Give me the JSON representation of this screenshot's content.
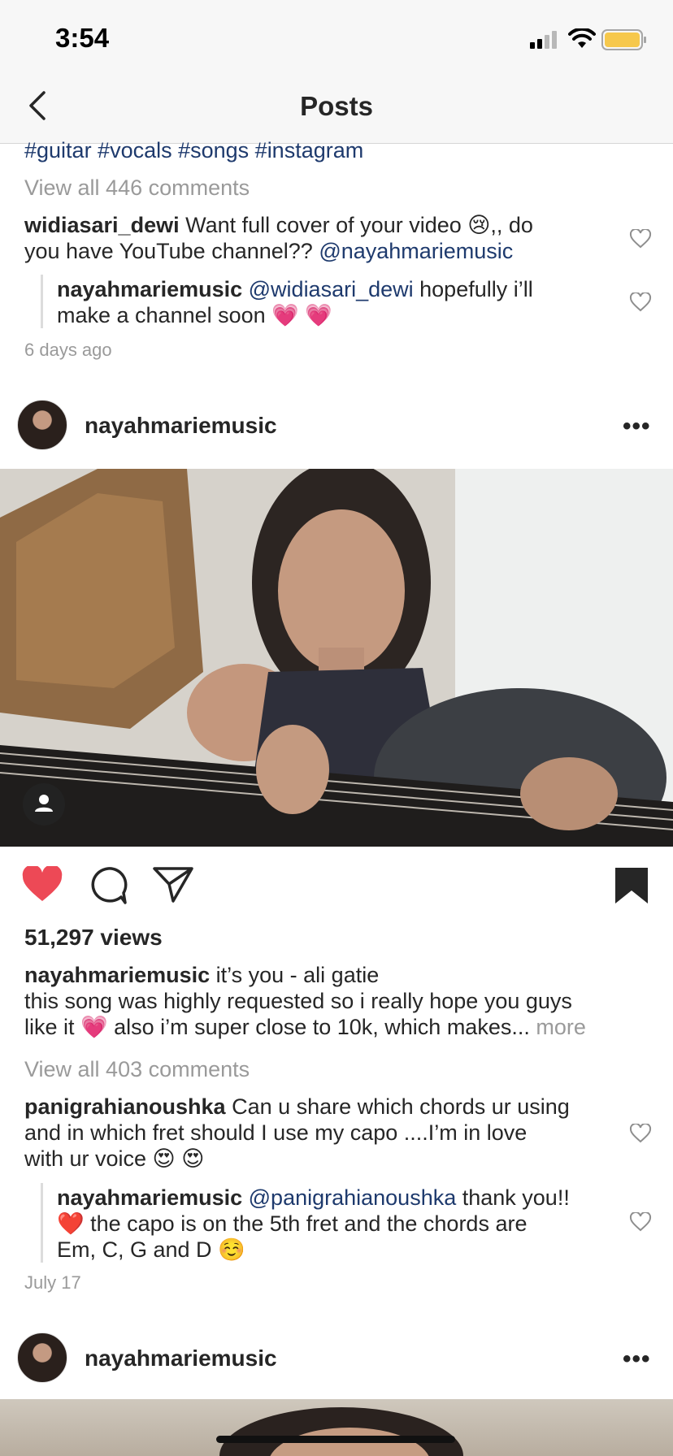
{
  "status_bar": {
    "time": "3:54"
  },
  "header": {
    "title": "Posts"
  },
  "post1": {
    "hashtags": "#guitar #vocals #songs #instagram",
    "view_comments": "View all 446 comments",
    "comment": {
      "user": "widiasari_dewi",
      "text_a": " Want full cover of your video 😢,, do",
      "text_b": "you have  YouTube channel?? ",
      "mention": "@nayahmariemusic"
    },
    "reply": {
      "user": "nayahmariemusic",
      "mention": "@widiasari_dewi",
      "text_a": " hopefully i’ll",
      "text_b": "make a channel soon 💗 💗"
    },
    "timestamp": "6 days ago"
  },
  "post2": {
    "username": "nayahmariemusic",
    "more_dots": "•••",
    "views": "51,297 views",
    "caption": {
      "user": "nayahmariemusic",
      "title": " it’s you - ali gatie",
      "line1": "this song was highly requested so i really hope you guys",
      "line2": "like it 💗 also i’m super close to 10k, which makes... ",
      "more": "more"
    },
    "view_comments": "View all 403 comments",
    "comment": {
      "user": "panigrahianoushka",
      "text_a": " Can u share which chords ur using",
      "text_b": "and in which fret should I use my capo ....I’m in love",
      "text_c": "with ur voice 😍 😍"
    },
    "reply": {
      "user": "nayahmariemusic",
      "mention": "@panigrahianoushka",
      "text_a": " thank you!!",
      "text_b": "❤️ the capo is on the 5th fret and the chords are",
      "text_c": "Em, C, G and D ☺️"
    },
    "timestamp": "July 17"
  },
  "post3": {
    "username": "nayahmariemusic",
    "more_dots": "•••"
  },
  "colors": {
    "like": "#ed4956",
    "link": "#1e3a6d",
    "muted": "#9a9a9a"
  }
}
